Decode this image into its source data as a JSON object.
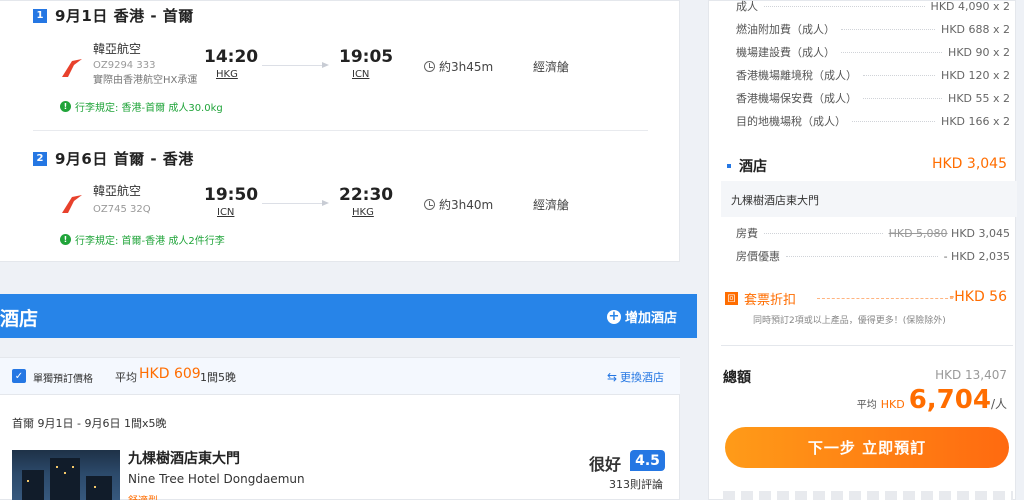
{
  "segments": [
    {
      "num": "1",
      "title": "9月1日  香港 - 首爾",
      "airline": "韓亞航空",
      "flight_no": "OZ9294 333",
      "codeshare": "實際由香港航空HX承運",
      "dep_time": "14:20",
      "dep_apt": "HKG",
      "arr_time": "19:05",
      "arr_apt": "ICN",
      "duration": "約3h45m",
      "cabin": "經濟艙",
      "baggage": "行李規定: 香港-首爾 成人30.0kg"
    },
    {
      "num": "2",
      "title": "9月6日  首爾 - 香港",
      "airline": "韓亞航空",
      "flight_no": "OZ745 32Q",
      "dep_time": "19:50",
      "dep_apt": "ICN",
      "arr_time": "22:30",
      "arr_apt": "HKG",
      "duration": "約3h40m",
      "cabin": "經濟艙",
      "baggage": "行李規定: 首爾-香港 成人2件行李"
    }
  ],
  "hotel_section": {
    "title": "酒店",
    "add_label": "增加酒店",
    "single_label": "單獨預訂價格",
    "avg_label": "平均",
    "avg_price": "HKD 609",
    "avg_room": "1間5晚",
    "change_label": "更換酒店",
    "stay_info": "首爾 9月1日 - 9月6日 1間x5晚",
    "hotel_cn": "九棵樹酒店東大門",
    "hotel_en": "Nine Tree Hotel Dongdaemun",
    "stars": "舒適型",
    "rating_word": "很好",
    "rating_score": "4.5",
    "reviews": "313則評論"
  },
  "summary": {
    "fees": [
      {
        "label": "成人",
        "value": "HKD 4,090 x 2"
      },
      {
        "label": "燃油附加費（成人）",
        "value": "HKD 688 x 2"
      },
      {
        "label": "機場建設費（成人）",
        "value": "HKD 90 x 2"
      },
      {
        "label": "香港機場離境稅（成人）",
        "value": "HKD 120 x 2"
      },
      {
        "label": "香港機場保安費（成人）",
        "value": "HKD 55 x 2"
      },
      {
        "label": "目的地機場稅（成人）",
        "value": "HKD 166 x 2"
      }
    ],
    "hotel_title": "酒店",
    "hotel_price": "HKD 3,045",
    "hotel_name": "九棵樹酒店東大門",
    "room_label": "房費",
    "room_old": "HKD 5,080",
    "room_new": "HKD 3,045",
    "room_disc_label": "房價優惠",
    "room_disc_value": "- HKD 2,035",
    "pkg_icon": "回",
    "pkg_label": "套票折扣",
    "pkg_value": "-HKD 56",
    "pkg_note": "同時預訂2項或以上產品，優得更多！(保險除外)",
    "total_label": "總額",
    "total_value": "HKD 13,407",
    "per_avg": "平均",
    "per_currency": "HKD",
    "per_amount": "6,704",
    "per_unit": "/人",
    "next_button": "下一步 立即預訂"
  },
  "colors": {
    "accent": "#2577e3",
    "orange": "#ff6d00",
    "baggage_green": "#20a43a"
  }
}
